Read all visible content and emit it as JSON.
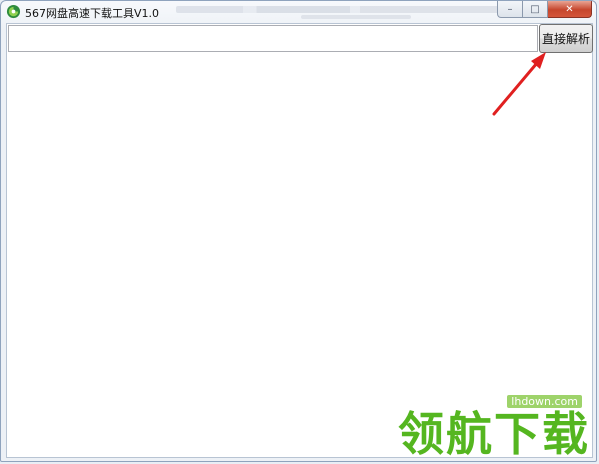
{
  "window": {
    "title": "567网盘高速下载工具V1.0",
    "controls": {
      "minimize": "–",
      "maximize": "□",
      "close": "✕"
    }
  },
  "main": {
    "url_input": {
      "value": "",
      "placeholder": ""
    },
    "parse_button_label": "直接解析"
  },
  "annotation": {
    "arrow_color": "#e02020"
  },
  "watermark": {
    "site": "lhdown.com",
    "brand": "领航下载"
  },
  "colors": {
    "brand_green": "#55b620",
    "close_red": "#c6462d"
  }
}
